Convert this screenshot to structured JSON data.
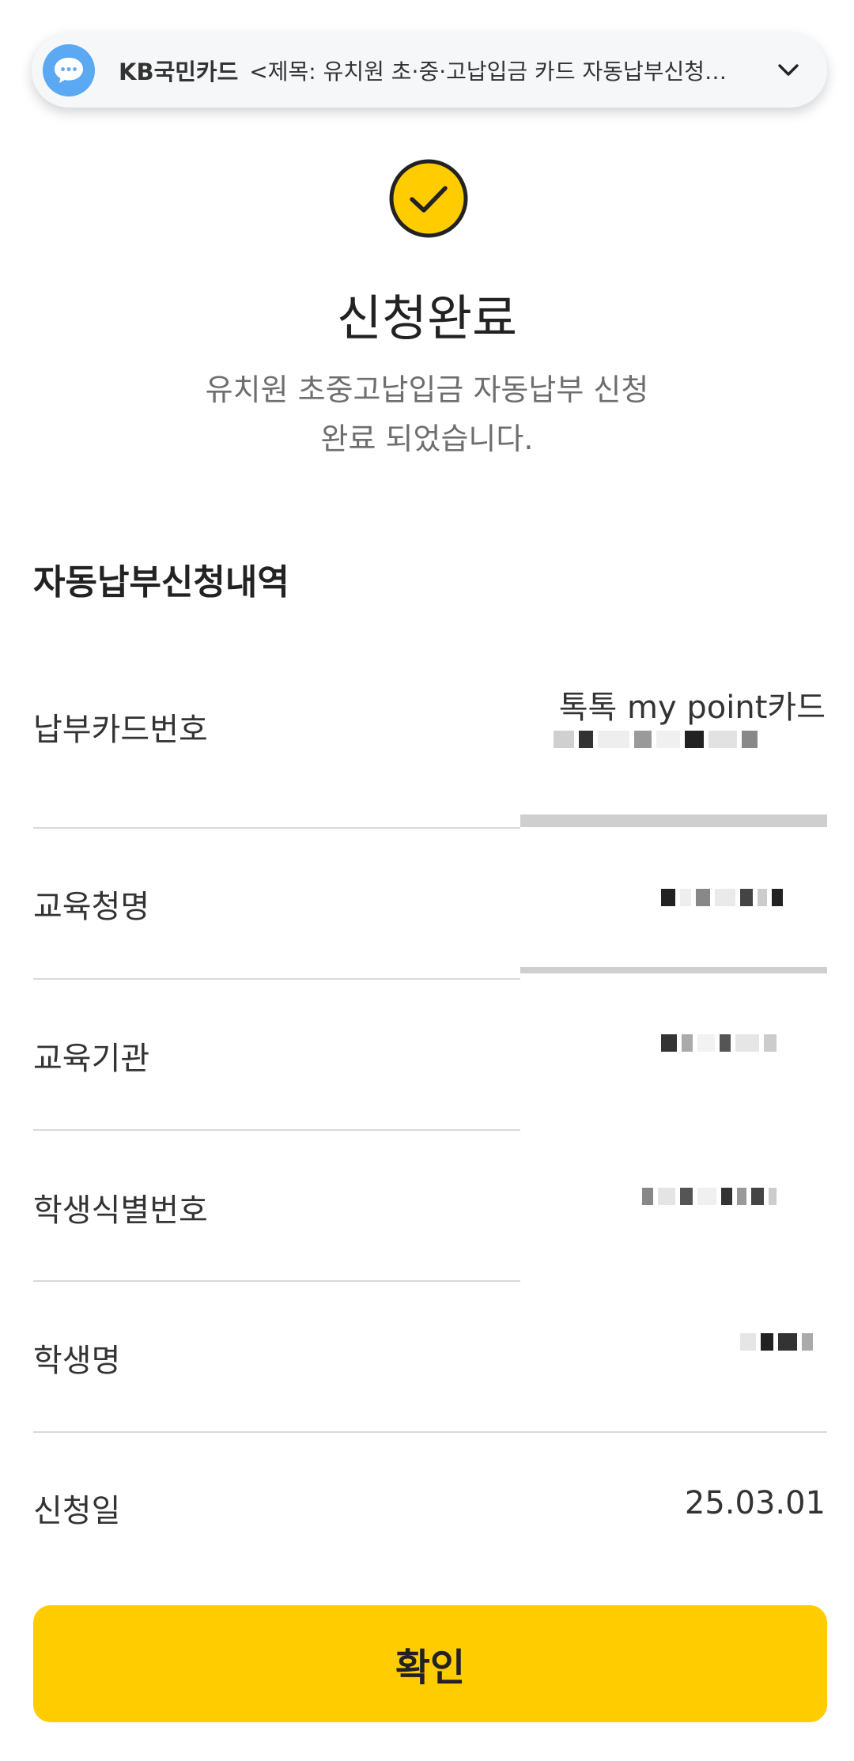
{
  "notification": {
    "sender": "KB국민카드",
    "message": "<제목: 유치원 초·중·고납입금 카드 자동납부신청…",
    "icon": "chat-bubble-icon",
    "icon_color": "#5aa9f2",
    "expand_icon": "chevron-down-icon"
  },
  "header": {
    "status_icon": "check-circle-icon",
    "status_icon_color": "#ffcc00",
    "title": "신청완료",
    "subtitle_line1": "유치원 초중고납입금 자동납부 신청",
    "subtitle_line2": "완료 되었습니다."
  },
  "section": {
    "title": "자동납부신청내역",
    "rows": [
      {
        "label": "납부카드번호",
        "value": "톡톡 my point카드"
      },
      {
        "label": "교육청명",
        "value": ""
      },
      {
        "label": "교육기관",
        "value": ""
      },
      {
        "label": "학생식별번호",
        "value": ""
      },
      {
        "label": "학생명",
        "value": ""
      },
      {
        "label": "신청일",
        "value": "25.03.01"
      }
    ]
  },
  "confirm_button": {
    "label": "확인",
    "color": "#ffcc00"
  }
}
